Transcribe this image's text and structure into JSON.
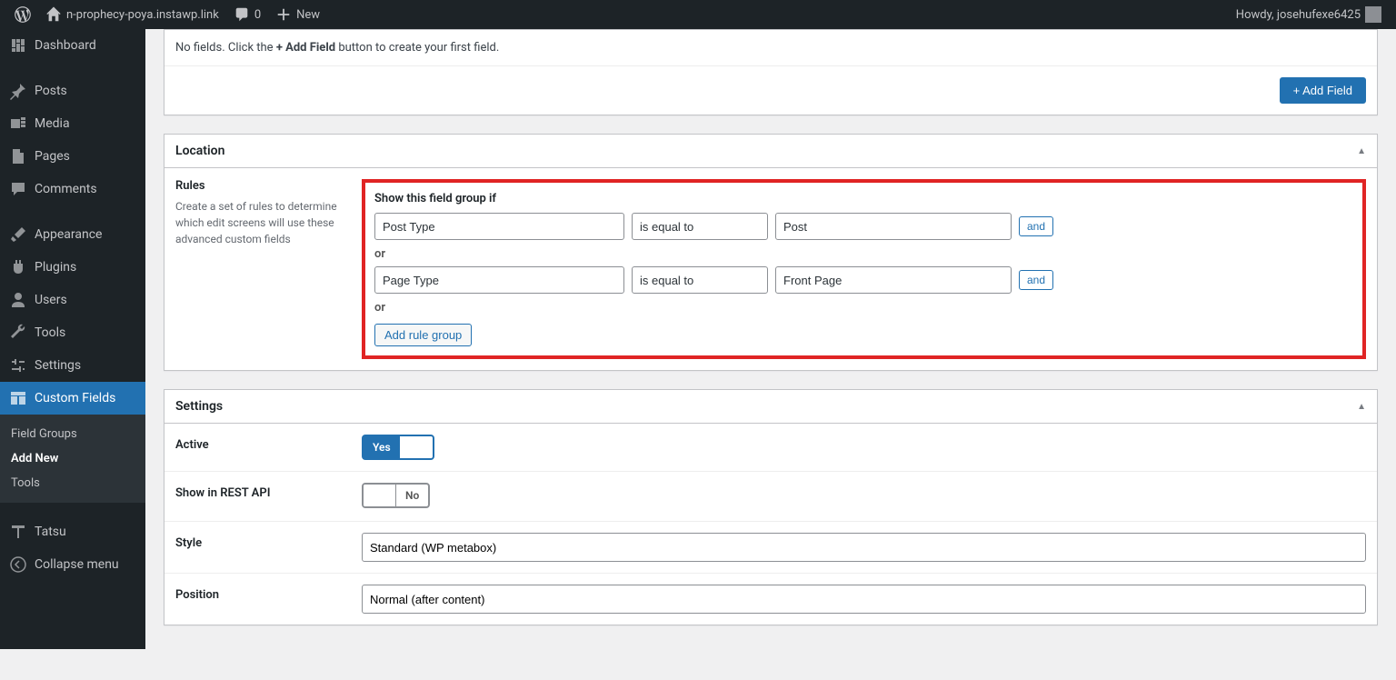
{
  "toolbar": {
    "site_name": "n-prophecy-poya.instawp.link",
    "comments_count": "0",
    "new_label": "New",
    "howdy": "Howdy, josehufexe6425"
  },
  "sidebar": {
    "items": [
      {
        "label": "Dashboard",
        "icon": "dashboard"
      },
      {
        "label": "Posts",
        "icon": "pin"
      },
      {
        "label": "Media",
        "icon": "media"
      },
      {
        "label": "Pages",
        "icon": "page"
      },
      {
        "label": "Comments",
        "icon": "comment"
      },
      {
        "label": "Appearance",
        "icon": "brush"
      },
      {
        "label": "Plugins",
        "icon": "plug"
      },
      {
        "label": "Users",
        "icon": "user"
      },
      {
        "label": "Tools",
        "icon": "wrench"
      },
      {
        "label": "Settings",
        "icon": "sliders"
      },
      {
        "label": "Custom Fields",
        "icon": "layout",
        "active": true
      },
      {
        "label": "Tatsu",
        "icon": "tatsu"
      },
      {
        "label": "Collapse menu",
        "icon": "collapse"
      }
    ],
    "submenu": {
      "items": [
        {
          "label": "Field Groups"
        },
        {
          "label": "Add New",
          "current": true
        },
        {
          "label": "Tools"
        }
      ]
    }
  },
  "fields_box": {
    "no_fields_prefix": "No fields. Click the ",
    "no_fields_bold": "+ Add Field",
    "no_fields_suffix": " button to create your first field.",
    "add_field_btn": "+ Add Field"
  },
  "location_box": {
    "title": "Location",
    "rules_heading": "Rules",
    "rules_desc": "Create a set of rules to determine which edit screens will use these advanced custom fields",
    "show_if_label": "Show this field group if",
    "rows": [
      {
        "param": "Post Type",
        "op": "is equal to",
        "val": "Post"
      },
      {
        "param": "Page Type",
        "op": "is equal to",
        "val": "Front Page"
      }
    ],
    "or_label": "or",
    "and_btn": "and",
    "add_group_btn": "Add rule group"
  },
  "settings_box": {
    "title": "Settings",
    "rows": {
      "active": {
        "label": "Active",
        "value": "Yes"
      },
      "rest": {
        "label": "Show in REST API",
        "value": "No"
      },
      "style": {
        "label": "Style",
        "value": "Standard (WP metabox)"
      },
      "position": {
        "label": "Position",
        "value": "Normal (after content)"
      }
    }
  }
}
